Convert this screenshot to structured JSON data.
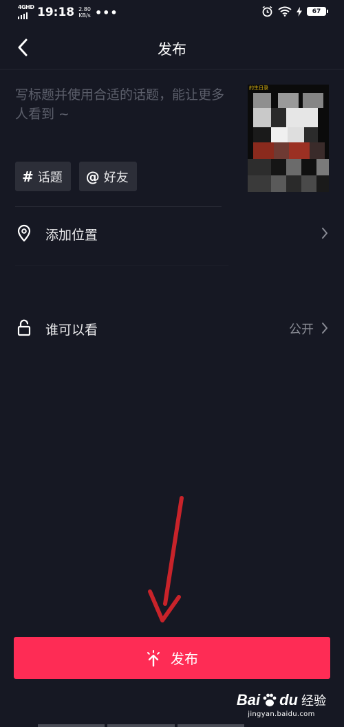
{
  "status_bar": {
    "network": "4GHD",
    "time": "19:18",
    "speed_value": "2.80",
    "speed_unit": "KB/s",
    "more": "•••",
    "battery": "67"
  },
  "nav": {
    "title": "发布"
  },
  "caption": {
    "placeholder": "写标题并使用合适的话题，能让更多人看到 ~"
  },
  "cover": {
    "label": "的生日录"
  },
  "chips": [
    {
      "symbol": "#",
      "label": "话题"
    },
    {
      "symbol": "@",
      "label": "好友"
    }
  ],
  "location": {
    "label": "添加位置"
  },
  "visibility": {
    "label": "谁可以看",
    "value": "公开"
  },
  "publish_button": {
    "label": "发布"
  },
  "watermark": {
    "brand_left": "Bai",
    "brand_right": "du",
    "brand_cn": "经验",
    "url": "jingyan.baidu.com"
  },
  "colors": {
    "background": "#161823",
    "accent": "#fe2c55",
    "chip": "#2c2e38",
    "arrow": "#c8232a"
  }
}
